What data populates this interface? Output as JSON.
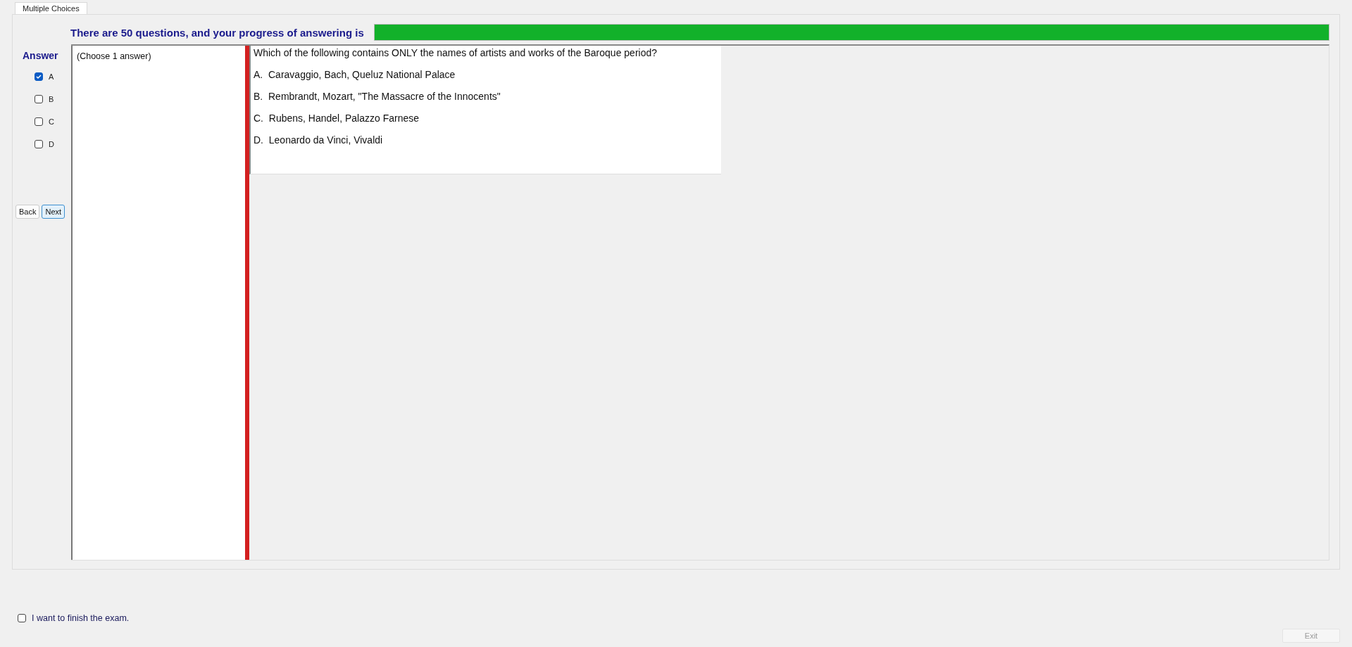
{
  "tabs": [
    {
      "label": "Multiple Choices",
      "selected": true
    }
  ],
  "progress": {
    "label": "There are 50 questions, and your progress of answering is",
    "level": 1
  },
  "answer_panel": {
    "title": "Answer",
    "options": [
      {
        "label": "A",
        "checked": true
      },
      {
        "label": "B",
        "checked": false
      },
      {
        "label": "C",
        "checked": false
      },
      {
        "label": "D",
        "checked": false
      }
    ],
    "buttons": [
      {
        "label": "Back",
        "focused": false
      },
      {
        "label": "Next",
        "focused": true
      }
    ]
  },
  "instruction": "(Choose 1 answer)",
  "question": {
    "text": "Which of the following contains ONLY the names of artists and works of the Baroque period?",
    "choices": [
      "A.  Caravaggio, Bach, Queluz National Palace",
      "B.  Rembrandt, Mozart, \"The Massacre of the Innocents\"",
      "C.  Rubens, Handel, Palazzo Farnese",
      "D.  Leonardo da Vinci, Vivaldi"
    ]
  },
  "finish": {
    "label": "I want to finish the exam.",
    "checked": false
  },
  "exit_button": {
    "label": "Exit",
    "disabled": true
  }
}
